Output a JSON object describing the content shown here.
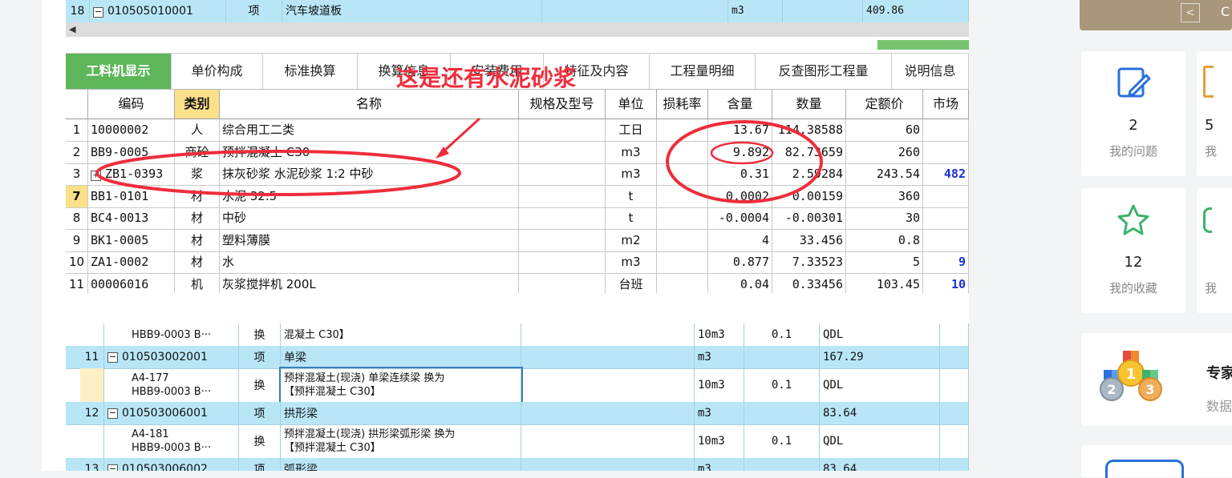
{
  "top_table": {
    "row": {
      "num": "18",
      "code": "010505010001",
      "type": "项",
      "name": "汽车坡道板",
      "unit": "m3",
      "quantity": "409.86"
    }
  },
  "tabs": [
    "工料机显示",
    "单价构成",
    "标准换算",
    "换算信息",
    "安装费用",
    "特征及内容",
    "工程量明细",
    "反查图形工程量",
    "说明信息"
  ],
  "grid": {
    "headers": [
      "编码",
      "类别",
      "名称",
      "规格及型号",
      "单位",
      "损耗率",
      "含量",
      "数量",
      "定额价",
      "市场"
    ],
    "rows": [
      {
        "num": "1",
        "code": "10000002",
        "cat": "人",
        "name": "综合用工二类",
        "spec": "",
        "unit": "工日",
        "loss": "",
        "content": "13.67",
        "qty": "114.38588",
        "price": "60",
        "market": ""
      },
      {
        "num": "2",
        "code": "BB9-0005",
        "cat": "商砼",
        "name": "预拌混凝土 C30",
        "spec": "",
        "unit": "m3",
        "loss": "",
        "content": "9.892",
        "qty": "82.73659",
        "price": "260",
        "market": ""
      },
      {
        "num": "3",
        "code": "ZB1-0393",
        "cat": "浆",
        "name": "抹灰砂浆 水泥砂浆 1:2 中砂",
        "spec": "",
        "unit": "m3",
        "loss": "",
        "content": "0.31",
        "qty": "2.59284",
        "price": "243.54",
        "market": "482"
      },
      {
        "num": "7",
        "code": "BB1-0101",
        "cat": "材",
        "name": "水泥 32.5",
        "spec": "",
        "unit": "t",
        "loss": "",
        "content": "0.0002",
        "qty": "0.00159",
        "price": "360",
        "market": ""
      },
      {
        "num": "8",
        "code": "BC4-0013",
        "cat": "材",
        "name": "中砂",
        "spec": "",
        "unit": "t",
        "loss": "",
        "content": "-0.0004",
        "qty": "-0.00301",
        "price": "30",
        "market": ""
      },
      {
        "num": "9",
        "code": "BK1-0005",
        "cat": "材",
        "name": "塑料薄膜",
        "spec": "",
        "unit": "m2",
        "loss": "",
        "content": "4",
        "qty": "33.456",
        "price": "0.8",
        "market": ""
      },
      {
        "num": "10",
        "code": "ZA1-0002",
        "cat": "材",
        "name": "水",
        "spec": "",
        "unit": "m3",
        "loss": "",
        "content": "0.877",
        "qty": "7.33523",
        "price": "5",
        "market": "9"
      },
      {
        "num": "11",
        "code": "00006016",
        "cat": "机",
        "name": "灰浆搅拌机 200L",
        "spec": "",
        "unit": "台班",
        "loss": "",
        "content": "0.04",
        "qty": "0.33456",
        "price": "103.45",
        "market": "10"
      }
    ]
  },
  "annotation": {
    "text": "这是还有水泥砂浆",
    "color": "#ee2d3c"
  },
  "bottom_table": {
    "rows": [
      {
        "num": "",
        "code_l1": "",
        "code_l2": "HBB9-0003 B···",
        "type": "换",
        "name_l1": "",
        "name_l2": "混凝土 C30】",
        "unit": "10m3",
        "coef": "0.1",
        "qty": "QDL",
        "blue": false,
        "sub": true
      },
      {
        "num": "11",
        "code_l1": "010503002001",
        "code_l2": "",
        "type": "项",
        "name_l1": "单梁",
        "name_l2": "",
        "unit": "m3",
        "coef": "",
        "qty": "167.29",
        "blue": true,
        "sub": false
      },
      {
        "num": "",
        "code_l1": "A4-177",
        "code_l2": "HBB9-0003 B···",
        "type": "换",
        "name_l1": "预拌混凝土(现浇) 单梁连续梁  换为",
        "name_l2": "【预拌混凝土 C30】",
        "unit": "10m3",
        "coef": "0.1",
        "qty": "QDL",
        "blue": false,
        "sub": true
      },
      {
        "num": "12",
        "code_l1": "010503006001",
        "code_l2": "",
        "type": "项",
        "name_l1": "拱形梁",
        "name_l2": "",
        "unit": "m3",
        "coef": "",
        "qty": "83.64",
        "blue": true,
        "sub": false
      },
      {
        "num": "",
        "code_l1": "A4-181",
        "code_l2": "HBB9-0003 B···",
        "type": "换",
        "name_l1": "预拌混凝土(现浇) 拱形梁弧形梁  换为",
        "name_l2": "【预拌混凝土 C30】",
        "unit": "10m3",
        "coef": "0.1",
        "qty": "QDL",
        "blue": false,
        "sub": true
      },
      {
        "num": "13",
        "code_l1": "010503006002",
        "code_l2": "",
        "type": "项",
        "name_l1": "弧形梁",
        "name_l2": "",
        "unit": "m3",
        "coef": "",
        "qty": "83.64",
        "blue": true,
        "sub": false
      }
    ]
  },
  "sidebar": {
    "cards": [
      {
        "count": "2",
        "label": "我的问题",
        "icon": "edit-icon"
      },
      {
        "count": "5",
        "label": "我",
        "icon": ""
      },
      {
        "count": "12",
        "label": "我的收藏",
        "icon": "star-icon"
      },
      {
        "count": "",
        "label": "我",
        "icon": ""
      }
    ],
    "expert": {
      "title": "专家",
      "subtitle": "数据",
      "icon": "medals-icon"
    },
    "top_partial": "C"
  },
  "colors": {
    "tab_active": "#5eb65a",
    "row_blue": "#b9e6f7",
    "accent_yellow": "#fbe08a",
    "icon_blue": "#2a6fdb",
    "icon_green": "#3bb36b"
  }
}
